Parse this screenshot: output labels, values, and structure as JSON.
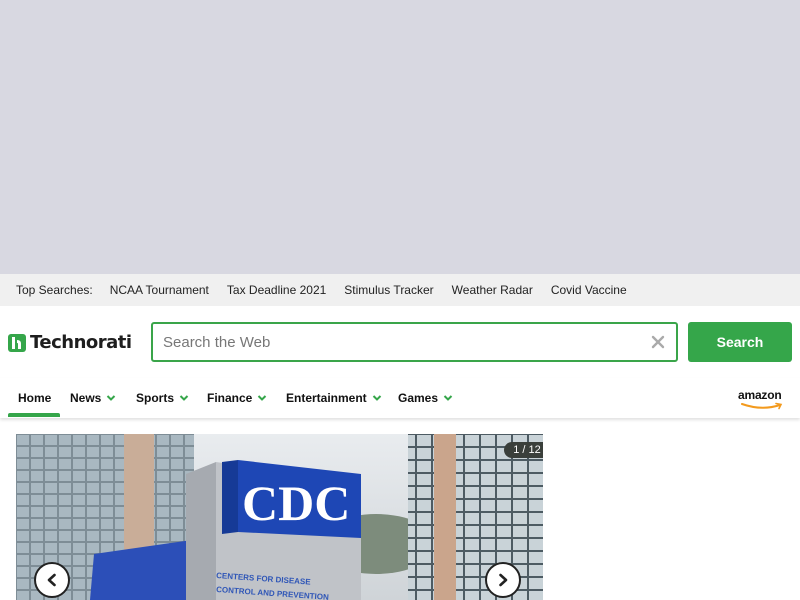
{
  "top_searches": {
    "label": "Top Searches:",
    "items": [
      "NCAA Tournament",
      "Tax Deadline 2021",
      "Stimulus Tracker",
      "Weather Radar",
      "Covid Vaccine"
    ]
  },
  "brand": {
    "name": "Technorati",
    "accent": "#35a64a"
  },
  "search": {
    "placeholder": "Search the Web",
    "value": "",
    "button_label": "Search"
  },
  "nav": {
    "items": [
      {
        "label": "Home",
        "dropdown": false,
        "active": true
      },
      {
        "label": "News",
        "dropdown": true
      },
      {
        "label": "Sports",
        "dropdown": true
      },
      {
        "label": "Finance",
        "dropdown": true
      },
      {
        "label": "Entertainment",
        "dropdown": true
      },
      {
        "label": "Games",
        "dropdown": true
      }
    ],
    "partner": "amazon"
  },
  "slideshow": {
    "counter": "1 / 12",
    "current": 1,
    "total": 12,
    "sign_text": "CDC",
    "sign_subtext": "CENTERS FOR DISEASE CONTROL AND PREVENTION"
  }
}
